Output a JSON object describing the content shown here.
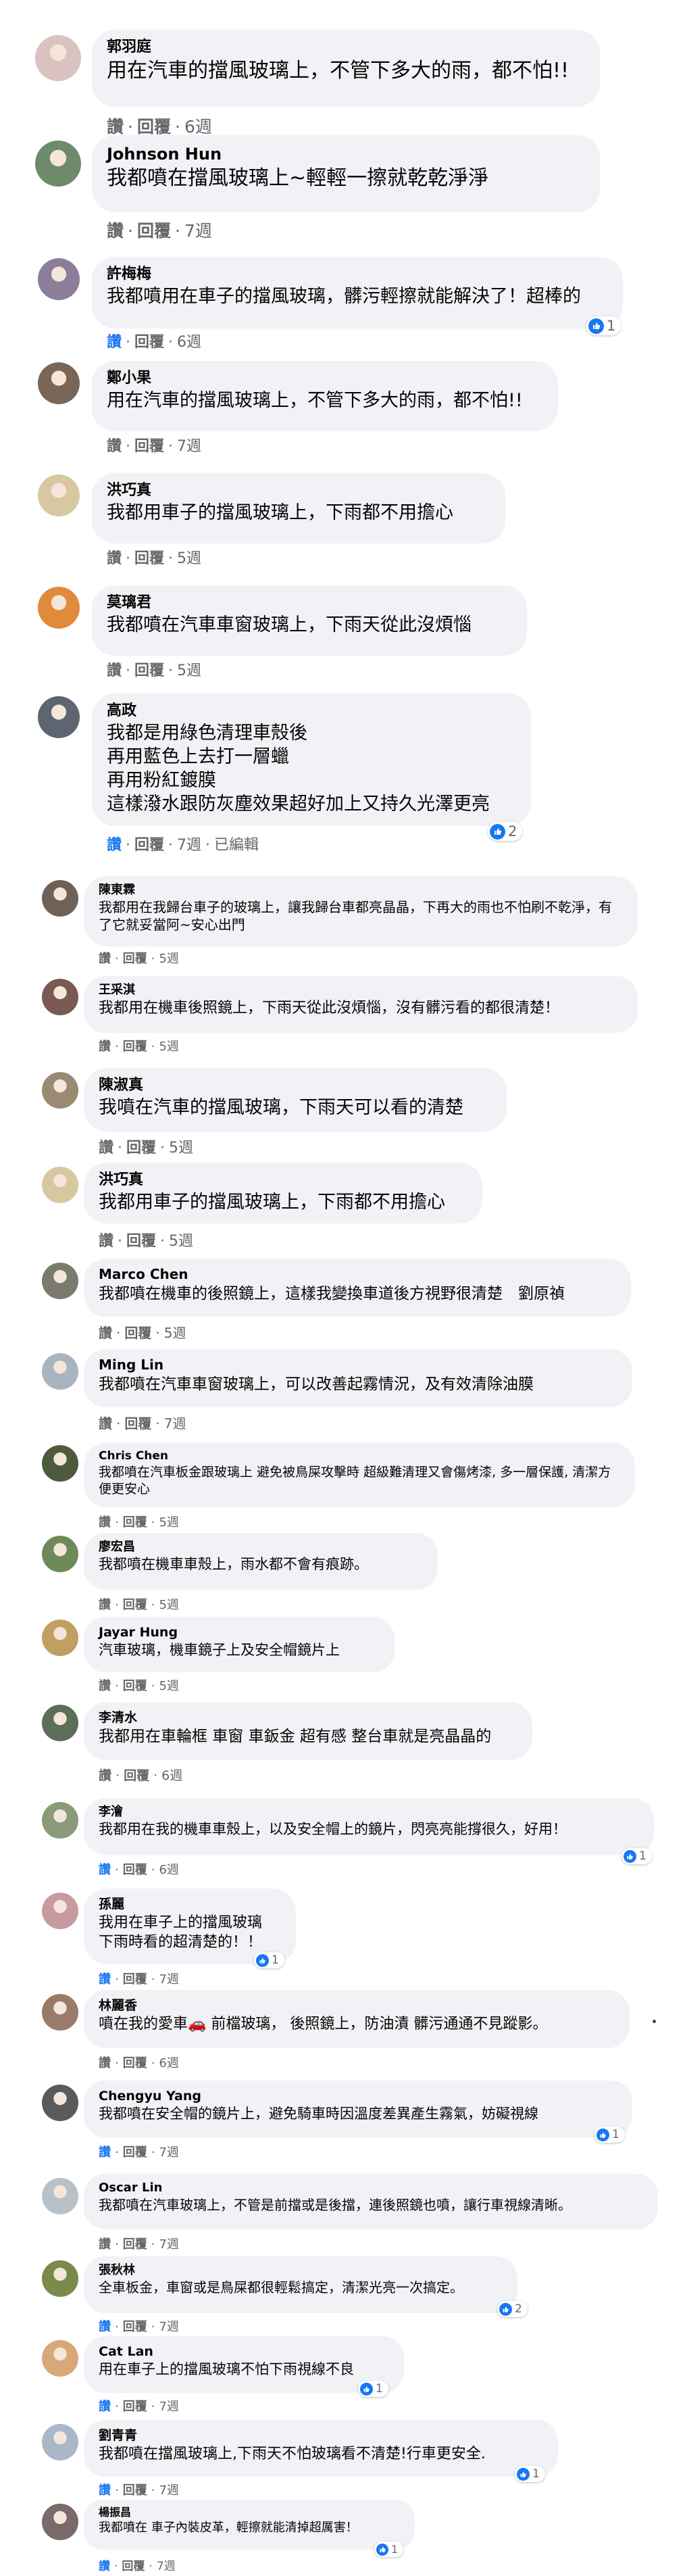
{
  "comments": [
    {
      "name": "郭羽庭",
      "text": "用在汽車的擋風玻璃上，不管下多大的雨，都不怕!!",
      "like": "讚",
      "reply": "回覆",
      "time": "6週",
      "avatar_color": "#d9c2c0"
    },
    {
      "name": "Johnson Hun",
      "text": "我都噴在擋風玻璃上~輕輕一擦就乾乾淨淨",
      "like": "讚",
      "reply": "回覆",
      "time": "7週",
      "avatar_color": "#6d8a6a"
    },
    {
      "name": "許梅梅",
      "text": "我都噴用在車子的擋風玻璃，髒污輕擦就能解決了！超棒的",
      "like": "讚",
      "reply": "回覆",
      "time": "6週",
      "reactions": "1",
      "avatar_color": "#8c7d9a"
    },
    {
      "name": "鄭小果",
      "text": "用在汽車的擋風玻璃上，不管下多大的雨，都不怕!!",
      "like": "讚",
      "reply": "回覆",
      "time": "7週",
      "avatar_color": "#7a6656"
    },
    {
      "name": "洪巧真",
      "text": "我都用車子的擋風玻璃上，下雨都不用擔心",
      "like": "讚",
      "reply": "回覆",
      "time": "5週",
      "avatar_color": "#d8c8a0"
    },
    {
      "name": "莫璃君",
      "text": "我都噴在汽車車窗玻璃上，下雨天從此沒煩惱",
      "like": "讚",
      "reply": "回覆",
      "time": "5週",
      "avatar_color": "#e08a3c"
    },
    {
      "name": "高政",
      "text": "我都是用綠色清理車殼後\n再用藍色上去打一層蠟\n再用粉紅鍍膜\n這樣潑水跟防灰塵效果超好加上又持久光澤更亮",
      "like": "讚",
      "reply": "回覆",
      "time": "7週",
      "extra": "已編輯",
      "reactions": "2",
      "avatar_color": "#5e6470"
    },
    {
      "name": "陳東霖",
      "text": "我都用在我歸台車子的玻璃上，讓我歸台車都亮晶晶，下再大的雨也不怕刷不乾淨，有了它就妥當阿~安心出門",
      "like": "讚",
      "reply": "回覆",
      "time": "5週",
      "avatar_color": "#6e6258"
    },
    {
      "name": "王采淇",
      "text": "我都用在機車後照鏡上，下雨天從此沒煩惱，沒有髒污看的都很清楚！",
      "like": "讚",
      "reply": "回覆",
      "time": "5週",
      "avatar_color": "#7a5a52"
    },
    {
      "name": "陳淑真",
      "text": "我噴在汽車的擋風玻璃，下雨天可以看的清楚",
      "like": "讚",
      "reply": "回覆",
      "time": "5週",
      "avatar_color": "#9a8a72"
    },
    {
      "name": "洪巧真",
      "text": "我都用車子的擋風玻璃上，下雨都不用擔心",
      "like": "讚",
      "reply": "回覆",
      "time": "5週",
      "avatar_color": "#d8c8a0"
    },
    {
      "name": "Marco Chen",
      "text": "我都噴在機車的後照鏡上，這樣我變換車道後方視野很清楚　劉原禎",
      "like": "讚",
      "reply": "回覆",
      "time": "5週",
      "avatar_color": "#7a7a6e"
    },
    {
      "name": "Ming Lin",
      "text": "我都噴在汽車車窗玻璃上，可以改善起霧情況，及有效清除油膜",
      "like": "讚",
      "reply": "回覆",
      "time": "7週",
      "avatar_color": "#a8b4c0"
    },
    {
      "name": "Chris Chen",
      "text": "我都噴在汽車板金跟玻璃上 避免被鳥屎攻擊時 超級難清理又會傷烤漆, 多一層保護, 清潔方便更安心",
      "like": "讚",
      "reply": "回覆",
      "time": "5週",
      "avatar_color": "#4e5a3e"
    },
    {
      "name": "廖宏昌",
      "text": "我都噴在機車車殼上，雨水都不會有痕跡。",
      "like": "讚",
      "reply": "回覆",
      "time": "5週",
      "avatar_color": "#6e8a5a"
    },
    {
      "name": "Jayar Hung",
      "text": "汽車玻璃，機車鏡子上及安全帽鏡片上",
      "like": "讚",
      "reply": "回覆",
      "time": "5週",
      "avatar_color": "#c0a060"
    },
    {
      "name": "李清水",
      "text": "我都用在車輪框 車窗 車鈑金 超有感 整台車就是亮晶晶的",
      "like": "讚",
      "reply": "回覆",
      "time": "6週",
      "avatar_color": "#5a6e58"
    },
    {
      "name": "李澮",
      "text": "我都用在我的機車車殼上，以及安全帽上的鏡片，閃亮亮能撐很久，好用！",
      "like": "讚",
      "reply": "回覆",
      "time": "6週",
      "reactions": "1",
      "avatar_color": "#8a9a7a"
    },
    {
      "name": "孫麗",
      "text": "我用在車子上的擋風玻璃\n下雨時看的超清楚的！！",
      "like": "讚",
      "reply": "回覆",
      "time": "7週",
      "reactions": "1",
      "avatar_color": "#c89aa0"
    },
    {
      "name": "林麗香",
      "text": "噴在我的愛車🚗 前檔玻璃， 後照鏡上，防油漬 髒污通通不見蹤影。",
      "like": "讚",
      "reply": "回覆",
      "time": "6週",
      "avatar_color": "#9a7a6a"
    },
    {
      "name": "Chengyu Yang",
      "text": "我都噴在安全帽的鏡片上，避免騎車時因溫度差異產生霧氣，妨礙視線",
      "like": "讚",
      "reply": "回覆",
      "time": "7週",
      "reactions": "1",
      "avatar_color": "#5a5a5a"
    },
    {
      "name": "Oscar Lin",
      "text": "我都噴在汽車玻璃上，不管是前擋或是後擋，連後照鏡也噴，讓行車視線清晰。",
      "like": "讚",
      "reply": "回覆",
      "time": "7週",
      "avatar_color": "#b8c0c8"
    },
    {
      "name": "張秋林",
      "text": "全車板金，車窗或是鳥屎都很輕鬆搞定，清潔光亮一次搞定。",
      "like": "讚",
      "reply": "回覆",
      "time": "7週",
      "reactions": "2",
      "avatar_color": "#7a8a4a"
    },
    {
      "name": "Cat Lan",
      "text": "用在車子上的擋風玻璃不怕下雨視線不良",
      "like": "讚",
      "reply": "回覆",
      "time": "7週",
      "reactions": "1",
      "avatar_color": "#d8a878"
    },
    {
      "name": "劉青青",
      "text": "我都噴在擋風玻璃上,下雨天不怕玻璃看不清楚!行車更安全.",
      "like": "讚",
      "reply": "回覆",
      "time": "7週",
      "reactions": "1",
      "avatar_color": "#a8b8c8"
    },
    {
      "name": "楊振昌",
      "text": "我都噴在 車子內裝皮革，輕擦就能清掉超厲害！",
      "like": "讚",
      "reply": "回覆",
      "time": "7週",
      "reactions": "1",
      "avatar_color": "#7a6a6a"
    }
  ]
}
